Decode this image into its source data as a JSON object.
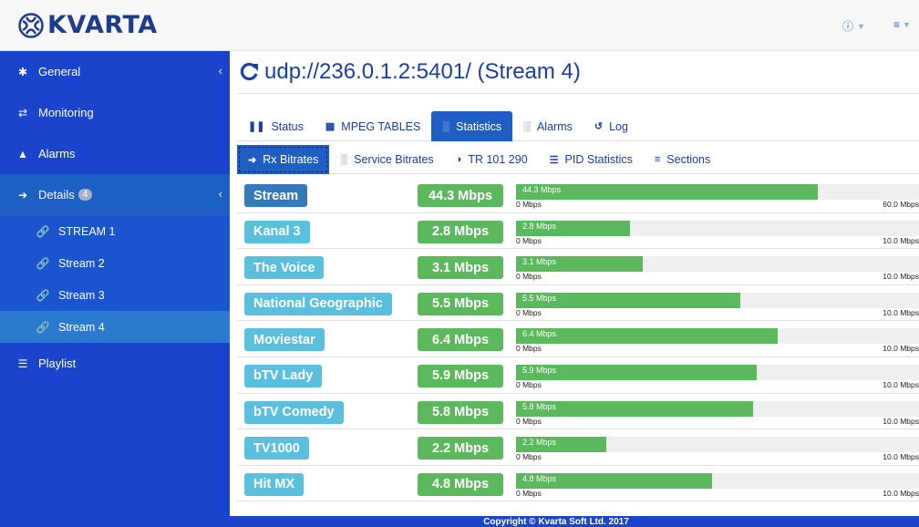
{
  "header": {
    "logo_text": "KVARTA"
  },
  "sidebar": {
    "items": [
      {
        "label": "General",
        "icon": "gear-icon"
      },
      {
        "label": "Monitoring",
        "icon": "monitor-icon"
      },
      {
        "label": "Alarms",
        "icon": "bell-icon"
      },
      {
        "label": "Details",
        "icon": "arrow-right-icon",
        "badge": "4"
      },
      {
        "label": "Playlist",
        "icon": "list-icon"
      }
    ],
    "details_children": [
      {
        "label": "STREAM 1",
        "icon": "link-icon"
      },
      {
        "label": "Stream 2",
        "icon": "link-icon"
      },
      {
        "label": "Stream 3",
        "icon": "link-icon"
      },
      {
        "label": "Stream 4",
        "icon": "link-icon",
        "active": true
      }
    ]
  },
  "main": {
    "title": "udp://236.0.1.2:5401/ (Stream 4)",
    "tabs": [
      {
        "label": "Status",
        "icon": "barcode-icon"
      },
      {
        "label": "MPEG TABLES",
        "icon": "table-icon"
      },
      {
        "label": "Statistics",
        "icon": "bar-chart-icon",
        "active": true
      },
      {
        "label": "Alarms",
        "icon": "bar-chart-icon"
      },
      {
        "label": "Log",
        "icon": "history-icon"
      }
    ],
    "subtabs": [
      {
        "label": "Rx Bitrates",
        "icon": "sign-in-icon",
        "active": true
      },
      {
        "label": "Service Bitrates",
        "icon": "bar-chart-icon"
      },
      {
        "label": "TR 101 290",
        "icon": "half-circle-icon"
      },
      {
        "label": "PID Statistics",
        "icon": "list-icon"
      },
      {
        "label": "Sections",
        "icon": "bars-icon"
      }
    ],
    "rows": [
      {
        "name": "Stream",
        "rate": "44.3 Mbps",
        "bar_text": "44.3 Mbps",
        "value": 44.3,
        "max": 60.0,
        "min_label": "0 Mbps",
        "max_label": "60.0 Mbps"
      },
      {
        "name": "Kanal 3",
        "rate": "2.8 Mbps",
        "bar_text": "2.8 Mbps",
        "value": 2.8,
        "max": 10.0,
        "min_label": "0 Mbps",
        "max_label": "10.0 Mbps"
      },
      {
        "name": "The Voice",
        "rate": "3.1 Mbps",
        "bar_text": "3.1 Mbps",
        "value": 3.1,
        "max": 10.0,
        "min_label": "0 Mbps",
        "max_label": "10.0 Mbps"
      },
      {
        "name": "National Geographic",
        "rate": "5.5 Mbps",
        "bar_text": "5.5 Mbps",
        "value": 5.5,
        "max": 10.0,
        "min_label": "0 Mbps",
        "max_label": "10.0 Mbps"
      },
      {
        "name": "Moviestar",
        "rate": "6.4 Mbps",
        "bar_text": "6.4 Mbps",
        "value": 6.4,
        "max": 10.0,
        "min_label": "0 Mbps",
        "max_label": "10.0 Mbps"
      },
      {
        "name": "bTV Lady",
        "rate": "5.9 Mbps",
        "bar_text": "5.9 Mbps",
        "value": 5.9,
        "max": 10.0,
        "min_label": "0 Mbps",
        "max_label": "10.0 Mbps"
      },
      {
        "name": "bTV Comedy",
        "rate": "5.8 Mbps",
        "bar_text": "5.8 Mbps",
        "value": 5.8,
        "max": 10.0,
        "min_label": "0 Mbps",
        "max_label": "10.0 Mbps"
      },
      {
        "name": "TV1000",
        "rate": "2.2 Mbps",
        "bar_text": "2.2 Mbps",
        "value": 2.2,
        "max": 10.0,
        "min_label": "0 Mbps",
        "max_label": "10.0 Mbps"
      },
      {
        "name": "Hit MX",
        "rate": "4.8 Mbps",
        "bar_text": "4.8 Mbps",
        "value": 4.8,
        "max": 10.0,
        "min_label": "0 Mbps",
        "max_label": "10.0 Mbps"
      }
    ]
  },
  "footer": {
    "text": "Copyright © Kvarta Soft Ltd. 2017"
  },
  "colors": {
    "sidebar_bg": "#1a44cc",
    "stream_label": "#337ab7",
    "service_label": "#5bc0de",
    "rate_label": "#5cb85c",
    "bar_fill": "#5cb85c",
    "active_tab": "#1f5fc4"
  }
}
